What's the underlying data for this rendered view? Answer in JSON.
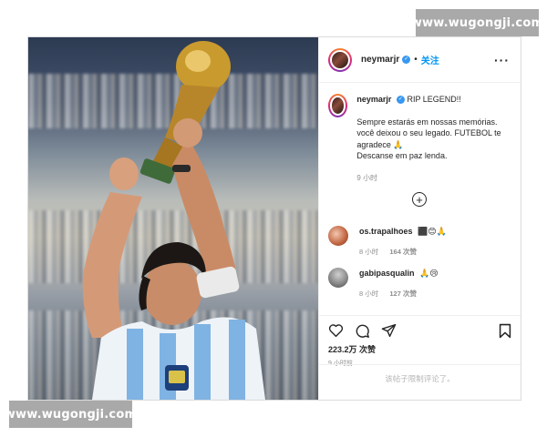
{
  "watermark": {
    "text": "www.wugongji.com"
  },
  "header": {
    "username": "neymarjr",
    "verified_mark": "✓",
    "separator": "•",
    "follow_label": "关注",
    "more_label": "···"
  },
  "caption": {
    "username": "neymarjr",
    "title": "RIP LEGEND!!",
    "text": "Sempre estarás em nossas memórias.\nvocê deixou o seu legado. FUTEBOL te agradece 🙏\nDescanse em paz lenda.",
    "time": "9 小时"
  },
  "load_more": {
    "label": "+"
  },
  "comments": [
    {
      "username": "os.trapalhoes",
      "emojis": "⬛😊🙏",
      "time": "8 小时",
      "likes": "164 次赞"
    },
    {
      "username": "gabipasqualin",
      "emojis": "🙏😢",
      "time": "8 小时",
      "likes": "127 次赞"
    }
  ],
  "actions": {
    "likes": "223.2万 次赞",
    "time": "9 小时前",
    "comments_disabled": "该帖子限制评论了。"
  },
  "icons": [
    "heart-icon",
    "comment-icon",
    "share-icon",
    "bookmark-icon",
    "verified-icon",
    "more-icon",
    "plus-circle-icon"
  ],
  "colors": {
    "accent": "#0095f6",
    "verified": "#3897f0",
    "muted": "#8e8e8e",
    "watermark_bg": "#a9a9a9"
  }
}
